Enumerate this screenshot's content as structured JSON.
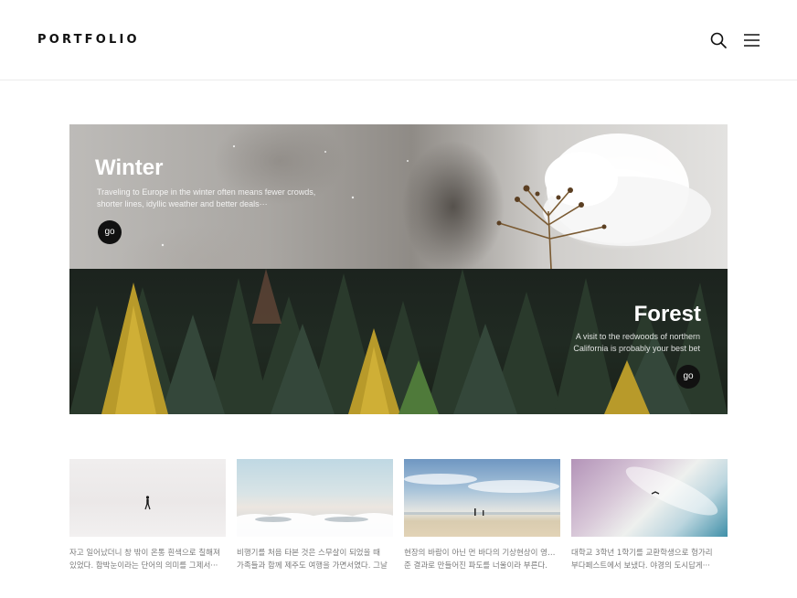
{
  "header": {
    "logo": "PORTFOLIO",
    "search_icon": "search-icon",
    "menu_icon": "hamburger-menu-icon"
  },
  "banners": {
    "winter": {
      "title": "Winter",
      "description_line1": "Traveling to Europe in the winter often means fewer crowds,",
      "description_line2": "shorter lines, idyllic weather and better deals···",
      "button": "go"
    },
    "forest": {
      "title": "Forest",
      "description_line1": "A visit to the redwoods of northern",
      "description_line2": "California is probably your best bet",
      "button": "go"
    }
  },
  "cards": [
    {
      "line1": "자고 일어났더니 창 밖이 온통 흰색으로 칠해져",
      "line2": "있었다. 함박눈이라는 단어의 의미를 그제서···"
    },
    {
      "line1": "비행기를 처음 타본 것은 스무살이 되었을 때",
      "line2": "가족들과 함께 제주도 여행을 가면서였다. 그날"
    },
    {
      "line1": "현장의 바람이 아닌 먼 바다의 기상현상이 영향을",
      "line2": "준 결과로 만들어진 파도를 너울이라 부른다."
    },
    {
      "line1": "대학교 3학년 1학기를 교환학생으로 헝가리",
      "line2": "부다페스트에서 보냈다. 야경의 도시답게···"
    }
  ],
  "colors": {
    "logo": "#111111",
    "button_bg": "#111111",
    "card_text": "#7a7a7a"
  }
}
